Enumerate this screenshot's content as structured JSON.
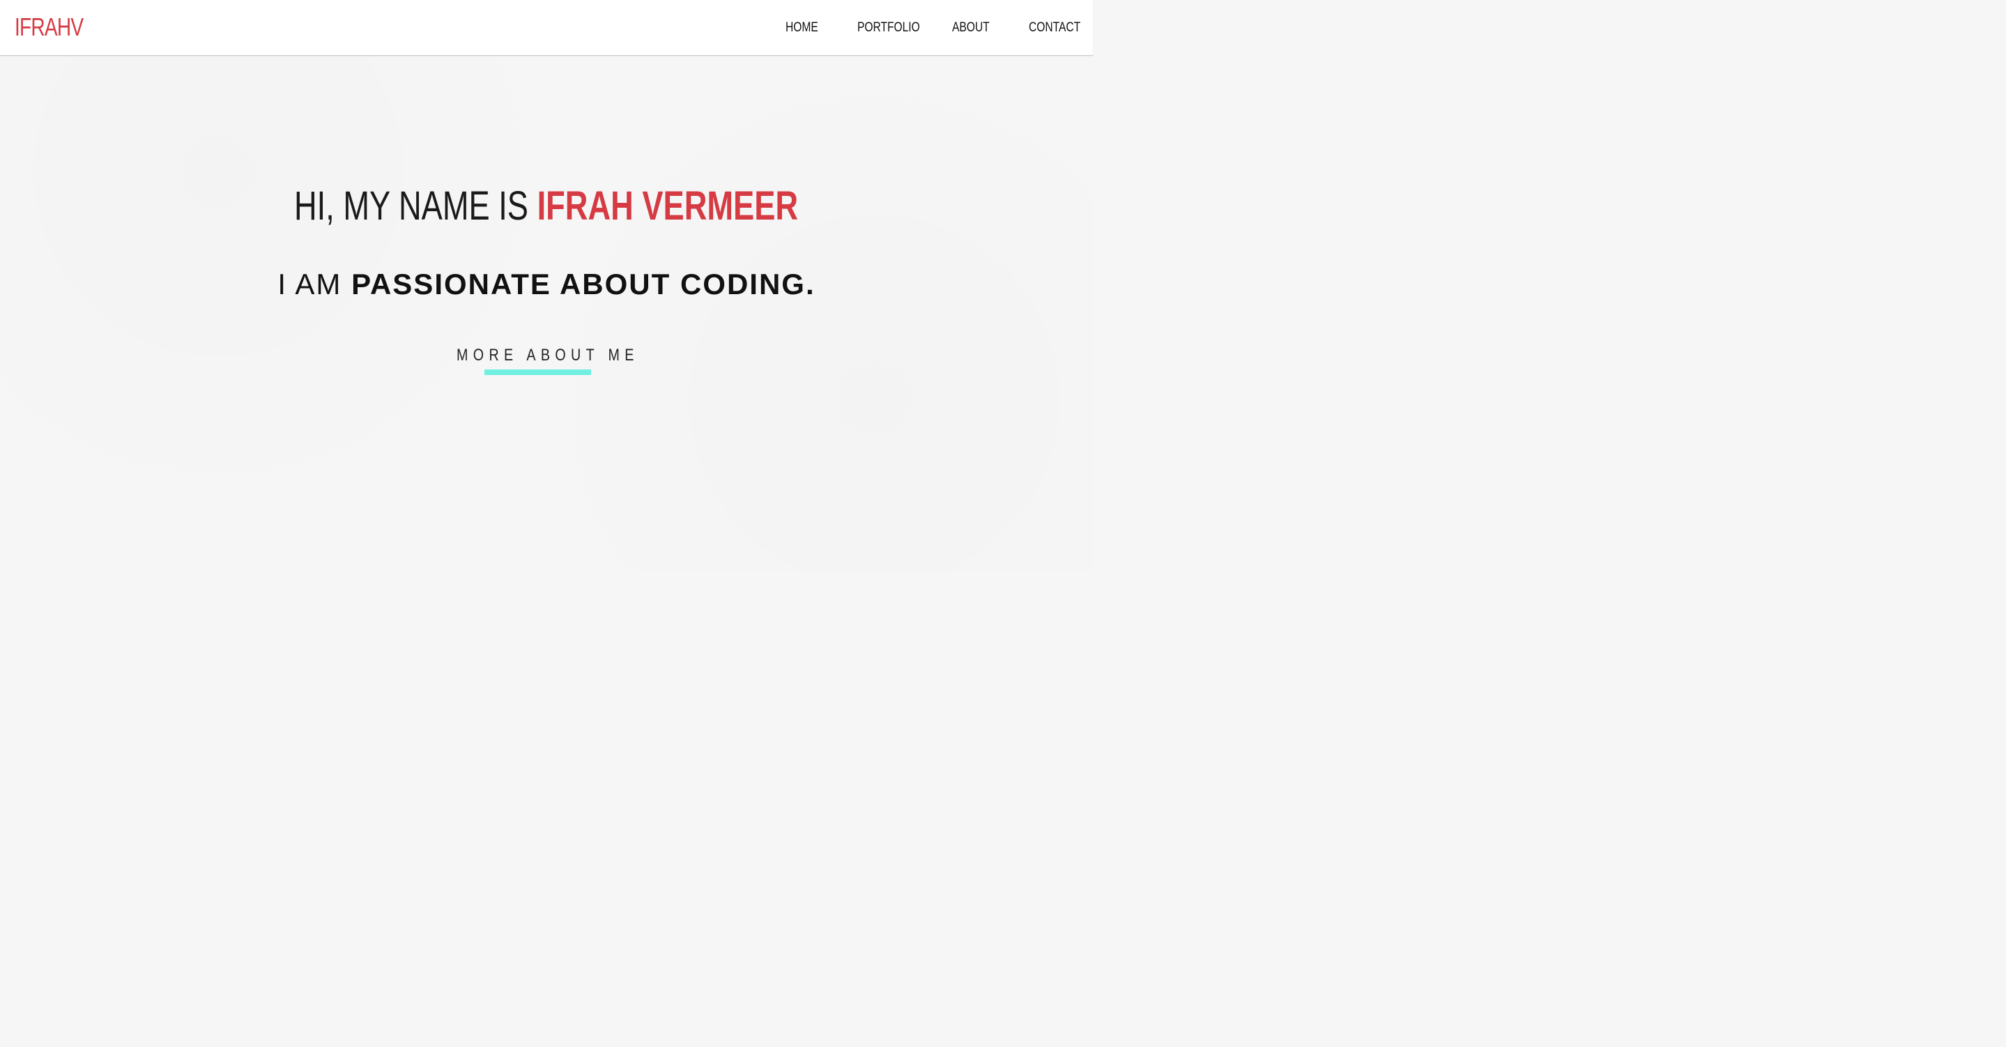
{
  "colors": {
    "accent": "#d63a43",
    "underline": "#6ff0e0",
    "text": "#111111",
    "background": "#f6f6f6",
    "navbar": "#ffffff"
  },
  "header": {
    "logo": "IFRAHV",
    "nav": {
      "home": "HOME",
      "portfolio": "PORTFOLIO",
      "about": "ABOUT",
      "contact": "CONTACT"
    }
  },
  "hero": {
    "greeting": "HI, MY NAME IS ",
    "name": "IFRAH VERMEER",
    "sub_prefix": "I AM ",
    "sub_emphasis": "PASSIONATE ABOUT CODING.",
    "cta_label": "MORE ABOUT ME"
  }
}
